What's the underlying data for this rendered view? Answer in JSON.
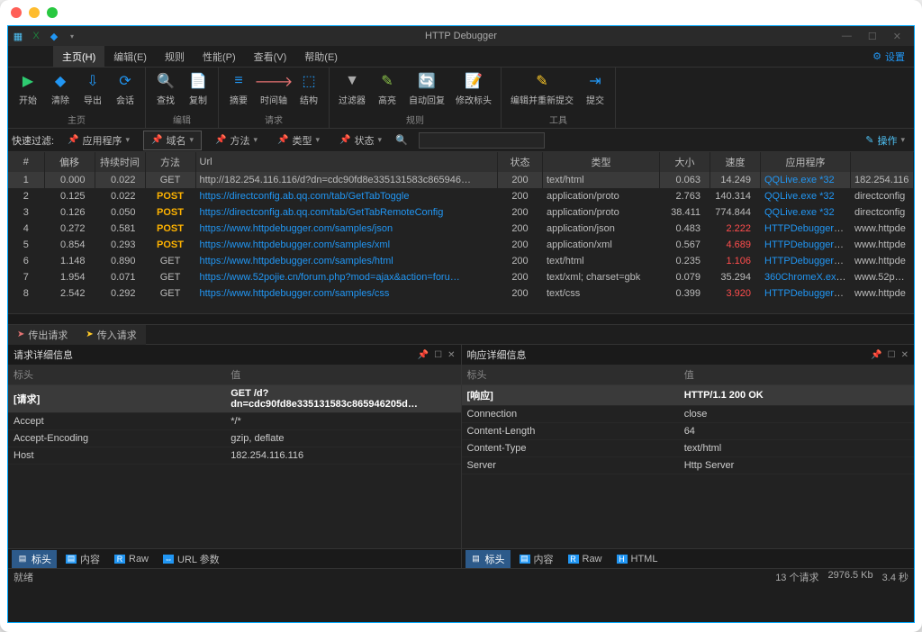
{
  "app_title": "HTTP Debugger",
  "menu": {
    "items": [
      "主页(H)",
      "编辑(E)",
      "规则",
      "性能(P)",
      "查看(V)",
      "帮助(E)"
    ],
    "settings": "设置"
  },
  "ribbon": {
    "groups": [
      {
        "label": "主页",
        "buttons": [
          {
            "icon": "▶",
            "color": "#2ecc71",
            "label": "开始"
          },
          {
            "icon": "◆",
            "color": "#2196f3",
            "label": "清除"
          },
          {
            "icon": "⇩",
            "color": "#2196f3",
            "label": "导出"
          },
          {
            "icon": "⟳",
            "color": "#2196f3",
            "label": "会话"
          }
        ]
      },
      {
        "label": "编辑",
        "buttons": [
          {
            "icon": "🔍",
            "color": "#2196f3",
            "label": "查找"
          },
          {
            "icon": "📄",
            "color": "#e0e0e0",
            "label": "复制"
          }
        ]
      },
      {
        "label": "请求",
        "buttons": [
          {
            "icon": "≡",
            "color": "#2196f3",
            "label": "摘要"
          },
          {
            "icon": "🡒",
            "color": "#e57373",
            "label": "时间轴"
          },
          {
            "icon": "⬚",
            "color": "#2196f3",
            "label": "结构"
          }
        ]
      },
      {
        "label": "规则",
        "buttons": [
          {
            "icon": "▼",
            "color": "#aaa",
            "label": "过滤器"
          },
          {
            "icon": "✎",
            "color": "#8bc34a",
            "label": "高亮"
          },
          {
            "icon": "🔄",
            "color": "#2196f3",
            "label": "自动回复"
          },
          {
            "icon": "📝",
            "color": "#2196f3",
            "label": "修改标头"
          }
        ]
      },
      {
        "label": "工具",
        "buttons": [
          {
            "icon": "✎",
            "color": "#ffca28",
            "label": "编辑并重新提交"
          },
          {
            "icon": "⇥",
            "color": "#2196f3",
            "label": "提交"
          }
        ]
      }
    ]
  },
  "filterbar": {
    "label": "快速过滤:",
    "app": "应用程序",
    "domain": "域名",
    "method": "方法",
    "type": "类型",
    "status": "状态",
    "op": "操作"
  },
  "grid": {
    "cols": [
      "#",
      "偏移",
      "持续时间",
      "方法",
      "Url",
      "状态",
      "类型",
      "大小",
      "速度",
      "应用程序",
      ""
    ],
    "rows": [
      {
        "n": "1",
        "off": "0.000",
        "dur": "0.022",
        "method": "GET",
        "url": "http://182.254.116.116/d?dn=cdc90fd8e335131583c865946…",
        "status": "200",
        "type": "text/html",
        "size": "0.063",
        "speed": "14.249",
        "speed_red": false,
        "app": "QQLive.exe *32",
        "host": "182.254.116"
      },
      {
        "n": "2",
        "off": "0.125",
        "dur": "0.022",
        "method": "POST",
        "url": "https://directconfig.ab.qq.com/tab/GetTabToggle",
        "status": "200",
        "type": "application/proto",
        "size": "2.763",
        "speed": "140.314",
        "speed_red": false,
        "app": "QQLive.exe *32",
        "host": "directconfig"
      },
      {
        "n": "3",
        "off": "0.126",
        "dur": "0.050",
        "method": "POST",
        "url": "https://directconfig.ab.qq.com/tab/GetTabRemoteConfig",
        "status": "200",
        "type": "application/proto",
        "size": "38.411",
        "speed": "774.844",
        "speed_red": false,
        "app": "QQLive.exe *32",
        "host": "directconfig"
      },
      {
        "n": "4",
        "off": "0.272",
        "dur": "0.581",
        "method": "POST",
        "url": "https://www.httpdebugger.com/samples/json",
        "status": "200",
        "type": "application/json",
        "size": "0.483",
        "speed": "2.222",
        "speed_red": true,
        "app": "HTTPDebuggerUI…",
        "host": "www.httpde"
      },
      {
        "n": "5",
        "off": "0.854",
        "dur": "0.293",
        "method": "POST",
        "url": "https://www.httpdebugger.com/samples/xml",
        "status": "200",
        "type": "application/xml",
        "size": "0.567",
        "speed": "4.689",
        "speed_red": true,
        "app": "HTTPDebuggerUI…",
        "host": "www.httpde"
      },
      {
        "n": "6",
        "off": "1.148",
        "dur": "0.890",
        "method": "GET",
        "url": "https://www.httpdebugger.com/samples/html",
        "status": "200",
        "type": "text/html",
        "size": "0.235",
        "speed": "1.106",
        "speed_red": true,
        "app": "HTTPDebuggerUI…",
        "host": "www.httpde"
      },
      {
        "n": "7",
        "off": "1.954",
        "dur": "0.071",
        "method": "GET",
        "url": "https://www.52pojie.cn/forum.php?mod=ajax&action=foru…",
        "status": "200",
        "type": "text/xml; charset=gbk",
        "size": "0.079",
        "speed": "35.294",
        "speed_red": false,
        "app": "360ChromeX.exe *…",
        "host": "www.52pojie"
      },
      {
        "n": "8",
        "off": "2.542",
        "dur": "0.292",
        "method": "GET",
        "url": "https://www.httpdebugger.com/samples/css",
        "status": "200",
        "type": "text/css",
        "size": "0.399",
        "speed": "3.920",
        "speed_red": true,
        "app": "HTTPDebuggerUI…",
        "host": "www.httpde"
      }
    ]
  },
  "midtabs": {
    "out": "传出请求",
    "in": "传入请求"
  },
  "req_pane": {
    "title": "请求详细信息",
    "hdr_key": "标头",
    "hdr_val": "值",
    "rows": [
      {
        "k": "[请求]",
        "v": "GET /d?dn=cdc90fd8e335131583c865946205d…",
        "bold": true
      },
      {
        "k": "Accept",
        "v": "*/*"
      },
      {
        "k": "Accept-Encoding",
        "v": "gzip, deflate"
      },
      {
        "k": "Host",
        "v": "182.254.116.116"
      }
    ],
    "tabs": [
      "标头",
      "内容",
      "Raw",
      "URL 参数"
    ]
  },
  "resp_pane": {
    "title": "响应详细信息",
    "hdr_key": "标头",
    "hdr_val": "值",
    "rows": [
      {
        "k": "[响应]",
        "v": "HTTP/1.1 200 OK",
        "bold": true
      },
      {
        "k": "Connection",
        "v": "close"
      },
      {
        "k": "Content-Length",
        "v": "64"
      },
      {
        "k": "Content-Type",
        "v": "text/html"
      },
      {
        "k": "Server",
        "v": "Http Server"
      }
    ],
    "tabs": [
      "标头",
      "内容",
      "Raw",
      "HTML"
    ]
  },
  "status": {
    "left": "就绪",
    "count": "13 个请求",
    "kb": "2976.5 Kb",
    "secs": "3.4 秒"
  }
}
